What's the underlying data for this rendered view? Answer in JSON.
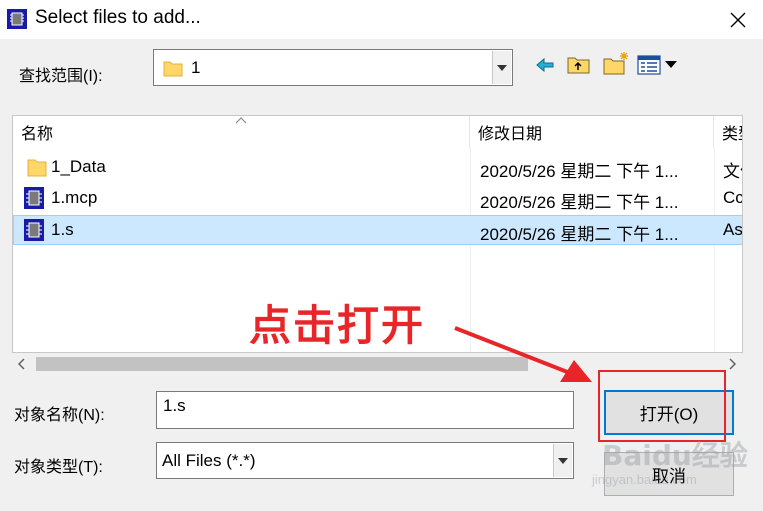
{
  "window": {
    "title": "Select files to add...",
    "icon": "program-chip-icon"
  },
  "look_in": {
    "label": "查找范围(I):",
    "value": "1"
  },
  "toolbar": {
    "icons": [
      "back-arrow-icon",
      "up-folder-icon",
      "new-folder-icon",
      "view-menu-icon"
    ]
  },
  "columns": {
    "name": "名称",
    "modified": "修改日期",
    "type": "类型"
  },
  "files": [
    {
      "name": "1_Data",
      "modified": "2020/5/26 星期二 下午 1...",
      "type": "文件夹",
      "icon": "folder-icon"
    },
    {
      "name": "1.mcp",
      "modified": "2020/5/26 星期二 下午 1...",
      "type": "Cc",
      "icon": "program-chip-icon"
    },
    {
      "name": "1.s",
      "modified": "2020/5/26 星期二 下午 1...",
      "type": "As",
      "icon": "program-chip-icon",
      "selected": true
    }
  ],
  "file_name": {
    "label": "对象名称(N):",
    "value": "1.s"
  },
  "file_type": {
    "label": "对象类型(T):",
    "value": "All Files (*.*)"
  },
  "buttons": {
    "open": "打开(O)",
    "cancel": "取消"
  },
  "annotation": {
    "text": "点击打开",
    "color": "#e8262a"
  },
  "watermark": {
    "text": "Baidu经验",
    "sub": "jingyan.baidu.com"
  },
  "colors": {
    "selection": "#cce8ff",
    "accent": "#0078d7"
  }
}
